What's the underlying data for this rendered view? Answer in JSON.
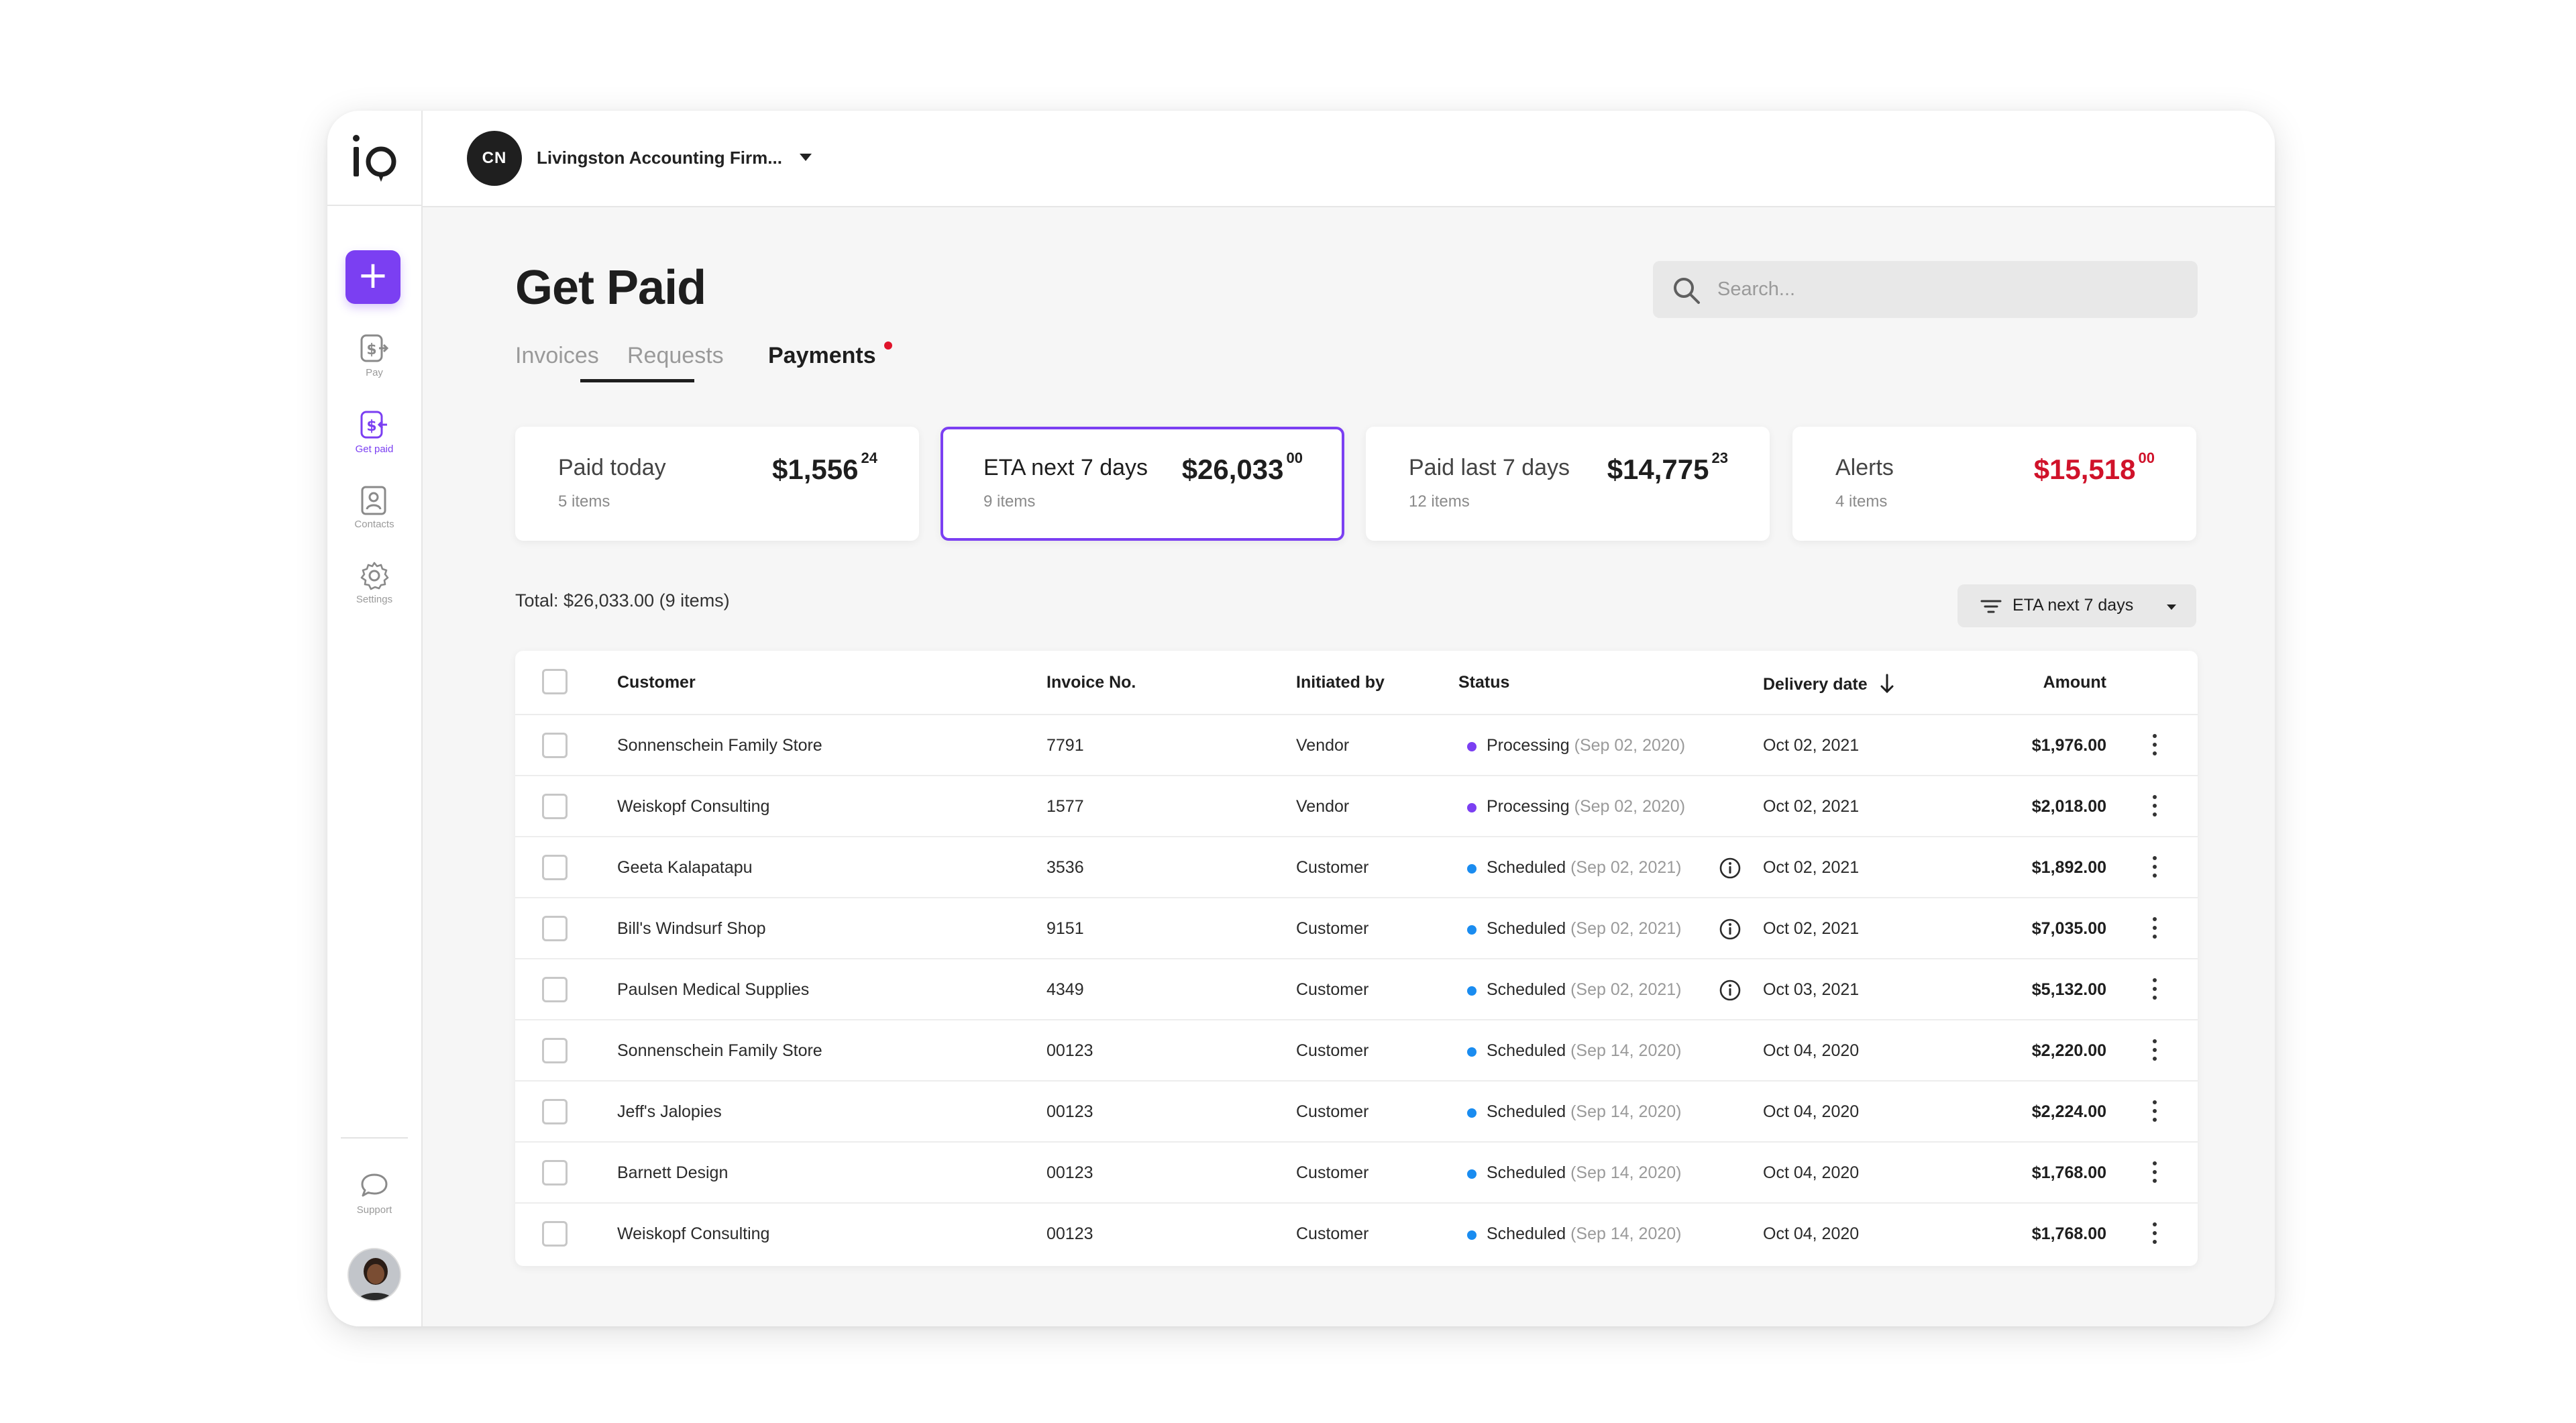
{
  "app": {
    "logo_text": "io",
    "org_initials": "CN",
    "org_name": "Livingston Accounting Firm...",
    "add_label": "+"
  },
  "nav": [
    {
      "label": "Pay",
      "icon": "dollar-arrow-icon"
    },
    {
      "label": "Get paid",
      "icon": "dollar-receive-icon",
      "active": true
    },
    {
      "label": "Contacts",
      "icon": "contact-card-icon"
    },
    {
      "label": "Settings",
      "icon": "gear-icon"
    }
  ],
  "support": {
    "label": "Support",
    "icon": "chat-bubble-icon"
  },
  "page": {
    "title": "Get Paid",
    "search_placeholder": "Search..."
  },
  "tabs": [
    {
      "label": "Invoices",
      "active": false
    },
    {
      "label": "Requests",
      "active": false
    },
    {
      "label": "Payments",
      "active": true
    }
  ],
  "cards": [
    {
      "label": "Paid today",
      "sub": "5 items",
      "amount": "$1,556",
      "cents": "24",
      "selected": false,
      "alert": false
    },
    {
      "label": "ETA next 7 days",
      "sub": "9 items",
      "amount": "$26,033",
      "cents": "00",
      "selected": true,
      "alert": false
    },
    {
      "label": "Paid last 7 days",
      "sub": "12 items",
      "amount": "$14,775",
      "cents": "23",
      "selected": false,
      "alert": false
    },
    {
      "label": "Alerts",
      "sub": "4 items",
      "amount": "$15,518",
      "cents": "00",
      "selected": false,
      "alert": true
    }
  ],
  "total_line": "Total: $26,033.00 (9 items)",
  "filter": {
    "label": "ETA next 7 days"
  },
  "colors": {
    "accent": "#7b3ff2",
    "alert": "#d0122a",
    "processing": "#7b3ff2",
    "scheduled": "#1a8cf0"
  },
  "table": {
    "headers": {
      "customer": "Customer",
      "invoice": "Invoice No.",
      "initiated": "Initiated by",
      "status": "Status",
      "delivery": "Delivery date",
      "amount": "Amount"
    },
    "rows": [
      {
        "customer": "Sonnenschein Family Store",
        "invoice": "7791",
        "initiated": "Vendor",
        "status": "Processing",
        "status_date": "(Sep 02, 2020)",
        "delivery": "Oct 02, 2021",
        "info": false,
        "amount": "$1,976.00"
      },
      {
        "customer": "Weiskopf Consulting",
        "invoice": "1577",
        "initiated": "Vendor",
        "status": "Processing",
        "status_date": "(Sep 02, 2020)",
        "delivery": "Oct 02, 2021",
        "info": false,
        "amount": "$2,018.00"
      },
      {
        "customer": "Geeta Kalapatapu",
        "invoice": "3536",
        "initiated": "Customer",
        "status": "Scheduled",
        "status_date": "(Sep 02, 2021)",
        "delivery": "Oct 02, 2021",
        "info": true,
        "amount": "$1,892.00"
      },
      {
        "customer": "Bill's Windsurf Shop",
        "invoice": "9151",
        "initiated": "Customer",
        "status": "Scheduled",
        "status_date": "(Sep 02, 2021)",
        "delivery": "Oct 02, 2021",
        "info": true,
        "amount": "$7,035.00"
      },
      {
        "customer": "Paulsen Medical Supplies",
        "invoice": "4349",
        "initiated": "Customer",
        "status": "Scheduled",
        "status_date": "(Sep 02, 2021)",
        "delivery": "Oct 03, 2021",
        "info": true,
        "amount": "$5,132.00"
      },
      {
        "customer": "Sonnenschein Family Store",
        "invoice": "00123",
        "initiated": "Customer",
        "status": "Scheduled",
        "status_date": "(Sep 14, 2020)",
        "delivery": "Oct 04, 2020",
        "info": false,
        "amount": "$2,220.00"
      },
      {
        "customer": "Jeff's Jalopies",
        "invoice": "00123",
        "initiated": "Customer",
        "status": "Scheduled",
        "status_date": "(Sep 14, 2020)",
        "delivery": "Oct 04, 2020",
        "info": false,
        "amount": "$2,224.00"
      },
      {
        "customer": "Barnett Design",
        "invoice": "00123",
        "initiated": "Customer",
        "status": "Scheduled",
        "status_date": "(Sep 14, 2020)",
        "delivery": "Oct 04, 2020",
        "info": false,
        "amount": "$1,768.00"
      },
      {
        "customer": "Weiskopf Consulting",
        "invoice": "00123",
        "initiated": "Customer",
        "status": "Scheduled",
        "status_date": "(Sep 14, 2020)",
        "delivery": "Oct 04, 2020",
        "info": false,
        "amount": "$1,768.00"
      }
    ]
  }
}
